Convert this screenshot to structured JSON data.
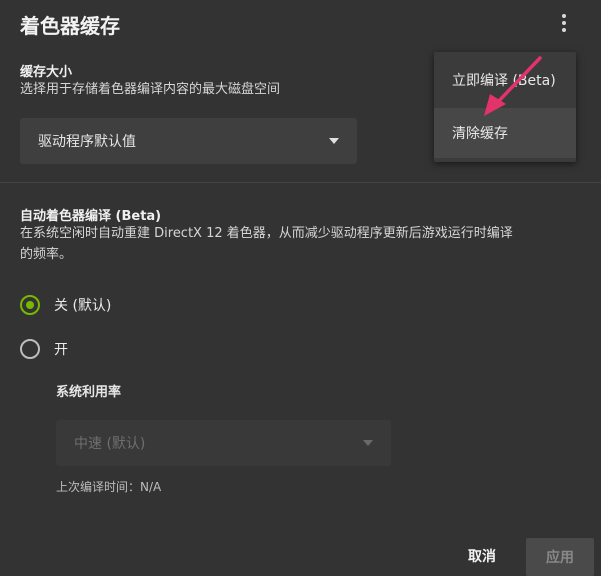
{
  "header": {
    "title": "着色器缓存"
  },
  "cache_size": {
    "title": "缓存大小",
    "description": "选择用于存储着色器编译内容的最大磁盘空间",
    "selected": "驱动程序默认值"
  },
  "auto_compile": {
    "title": "自动着色器编译 (Beta)",
    "description_line1": "在系统空闲时自动重建 DirectX 12 着色器，从而减少驱动程序更新后游戏运行时编译",
    "description_line2": "的频率。",
    "options": [
      {
        "label": "关 (默认)",
        "selected": true
      },
      {
        "label": "开",
        "selected": false
      }
    ],
    "utilization_title": "系统利用率",
    "utilization_selected": "中速 (默认)",
    "last_compile": "上次编译时间：N/A"
  },
  "footer": {
    "cancel": "取消",
    "apply": "应用"
  },
  "overflow_menu": {
    "items": [
      {
        "label": "立即编译 (Beta)"
      },
      {
        "label": "清除缓存"
      }
    ]
  },
  "colors": {
    "accent": "#76b900",
    "cursor": "#e2336b",
    "background": "#333333"
  }
}
